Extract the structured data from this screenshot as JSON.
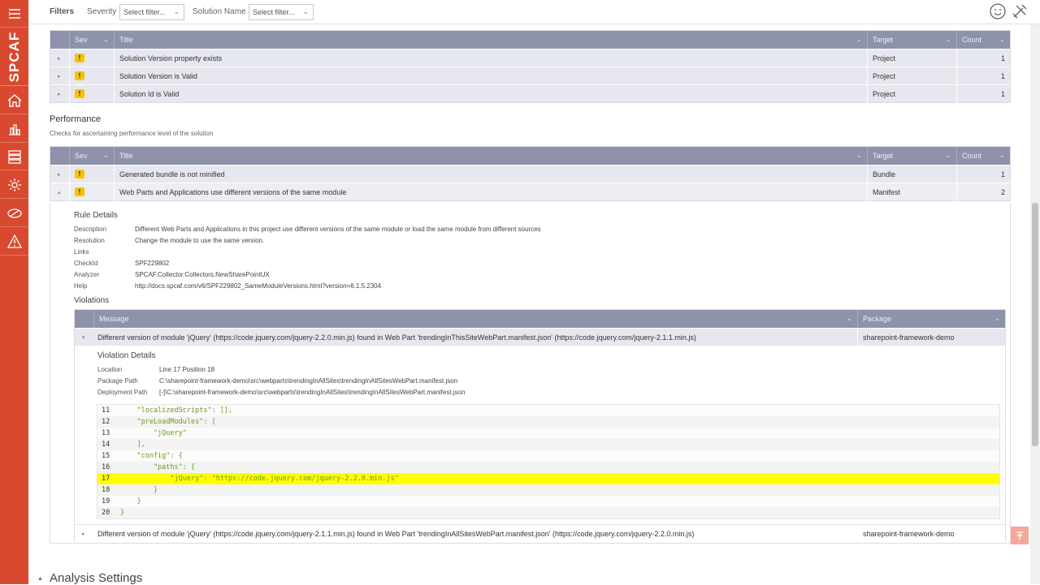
{
  "sidebar": {
    "logo": "SPCAF",
    "items": [
      {
        "icon": "menu-icon"
      },
      {
        "icon": "home-icon"
      },
      {
        "icon": "chart-icon"
      },
      {
        "icon": "list-icon"
      },
      {
        "icon": "gear-icon"
      },
      {
        "icon": "tag-icon"
      },
      {
        "icon": "warning-icon"
      }
    ]
  },
  "topbar": {
    "filters_label": "Filters",
    "severity_label": "Severity",
    "severity_placeholder": "Select filter...",
    "solution_label": "Solution Name",
    "solution_placeholder": "Select filter..."
  },
  "columns": {
    "sev": "Sev",
    "title": "Title",
    "target": "Target",
    "count": "Count",
    "message": "Message",
    "package": "Package"
  },
  "top_rows": [
    {
      "title": "Solution Version property exists",
      "target": "Project",
      "count": "1"
    },
    {
      "title": "Solution Version is Valid",
      "target": "Project",
      "count": "1"
    },
    {
      "title": "Solution Id is Valid",
      "target": "Project",
      "count": "1"
    }
  ],
  "performance": {
    "title": "Performance",
    "subtitle": "Checks for ascertaining performance level of the solution",
    "rows": [
      {
        "title": "Generated bundle is not minified",
        "target": "Bundle",
        "count": "1"
      },
      {
        "title": "Web Parts and Applications use different versions of the same module",
        "target": "Manifest",
        "count": "2"
      }
    ]
  },
  "rule_details": {
    "heading": "Rule Details",
    "description_key": "Description",
    "description": "Different Web Parts and Applications in this project use different versions of the same module or load the same module from different sources",
    "resolution_key": "Resolution",
    "resolution": "Change the module to use the same version.",
    "links_key": "Links",
    "checkid_key": "CheckId",
    "checkid": "SPF229802",
    "analyzer_key": "Analyzer",
    "analyzer": "SPCAF.Collector.Collectors.NewSharePointUX",
    "help_key": "Help",
    "help": "http://docs.spcaf.com/v6/SPF229802_SameModuleVersions.html?version=6.1.5.2304"
  },
  "violations": {
    "heading": "Violations",
    "rows": [
      {
        "message": "Different version of module 'jQuery' (https://code.jquery.com/jquery-2.2.0.min.js) found in Web Part 'trendingInThisSiteWebPart.manifest.json' (https://code.jquery.com/jquery-2.1.1.min.js)",
        "package": "sharepoint-framework-demo"
      },
      {
        "message": "Different version of module 'jQuery' (https://code.jquery.com/jquery-2.1.1.min.js) found in Web Part 'trendingInAllSitesWebPart.manifest.json' (https://code.jquery.com/jquery-2.2.0.min.js)",
        "package": "sharepoint-framework-demo"
      }
    ]
  },
  "violation_details": {
    "heading": "Violation Details",
    "location_key": "Location",
    "location": "Line 17 Position 18",
    "package_path_key": "Package Path",
    "package_path": "C:\\sharepoint-framework-demo\\src\\webparts\\trendingInAllSites\\trendingInAllSitesWebPart.manifest.json",
    "deployment_path_key": "Deployment Path",
    "deployment_path": "[-]\\C:\\sharepoint-framework-demo\\src\\webparts\\trendingInAllSites\\trendingInAllSitesWebPart.manifest.json"
  },
  "code_lines": [
    {
      "n": "11",
      "text": "    \"localizedScripts\": [],"
    },
    {
      "n": "12",
      "text": "    \"preLoadModules\": ["
    },
    {
      "n": "13",
      "text": "        \"jQuery\""
    },
    {
      "n": "14",
      "text": "    ],"
    },
    {
      "n": "15",
      "text": "    \"config\": {"
    },
    {
      "n": "16",
      "text": "        \"paths\": {"
    },
    {
      "n": "17",
      "text": "            \"jQuery\": \"https://code.jquery.com/jquery-2.2.0.min.js\"",
      "highlight": true
    },
    {
      "n": "18",
      "text": "        }"
    },
    {
      "n": "19",
      "text": "    }"
    },
    {
      "n": "20",
      "text": "}"
    }
  ],
  "analysis_settings": "Analysis Settings",
  "colors": {
    "sidebar": "#d9492f",
    "grid_header": "#8e93ab",
    "row_bg": "#e6e7ef",
    "warning": "#f5c400",
    "highlight": "#ffff00",
    "code_text": "#6a9a1f"
  }
}
